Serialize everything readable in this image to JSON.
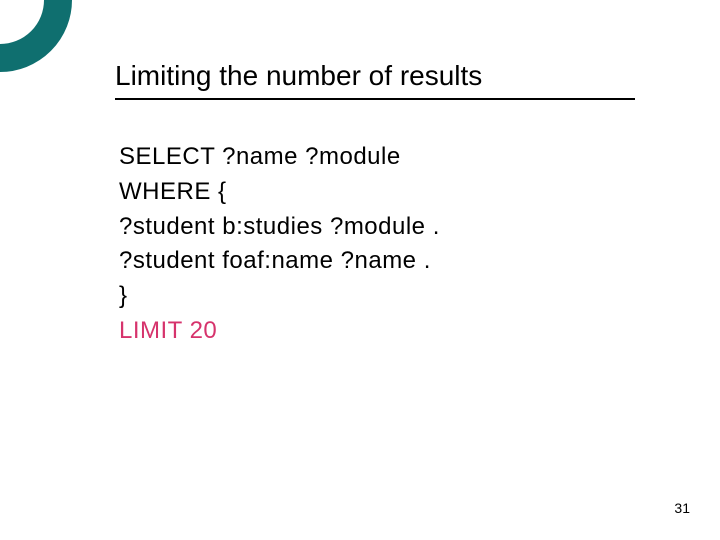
{
  "title": "Limiting the number of results",
  "code": {
    "l1": "SELECT ?name ?module",
    "l2": "WHERE {",
    "l3": "?student b:studies ?module .",
    "l4": "?student foaf:name ?name .",
    "l5": "}",
    "l6": "LIMIT 20"
  },
  "page_number": "31"
}
